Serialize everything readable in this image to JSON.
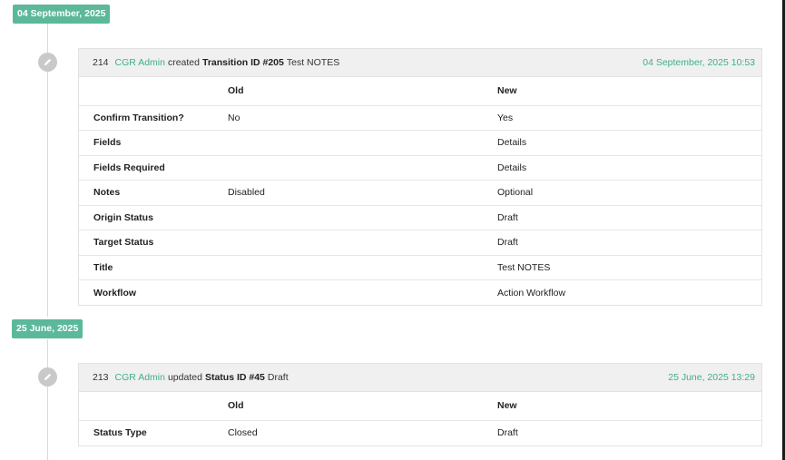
{
  "groups": [
    {
      "date": "04 September, 2025",
      "entry": {
        "id": "214",
        "user": "CGR Admin",
        "action": "created",
        "object": "Transition ID #205",
        "name": "Test NOTES",
        "timestamp": "04 September, 2025 10:53",
        "headers": {
          "field": "",
          "old": "Old",
          "new": "New"
        },
        "rows": [
          {
            "field": "Confirm Transition?",
            "old": "No",
            "new": "Yes"
          },
          {
            "field": "Fields",
            "old": "",
            "new": "Details"
          },
          {
            "field": "Fields Required",
            "old": "",
            "new": "Details"
          },
          {
            "field": "Notes",
            "old": "Disabled",
            "new": "Optional"
          },
          {
            "field": "Origin Status",
            "old": "",
            "new": "Draft"
          },
          {
            "field": "Target Status",
            "old": "",
            "new": "Draft"
          },
          {
            "field": "Title",
            "old": "",
            "new": "Test NOTES"
          },
          {
            "field": "Workflow",
            "old": "",
            "new": "Action Workflow"
          }
        ]
      }
    },
    {
      "date": "25 June, 2025",
      "entry": {
        "id": "213",
        "user": "CGR Admin",
        "action": "updated",
        "object": "Status ID #45",
        "name": "Draft",
        "timestamp": "25 June, 2025 13:29",
        "headers": {
          "field": "",
          "old": "Old",
          "new": "New"
        },
        "rows": [
          {
            "field": "Status Type",
            "old": "Closed",
            "new": "Draft"
          }
        ]
      }
    }
  ],
  "icons": {
    "entry_icon": "pencil-icon"
  },
  "colors": {
    "accent": "#5cb89a",
    "link": "#3fae8c",
    "icon_bg": "#c9c9c9"
  }
}
